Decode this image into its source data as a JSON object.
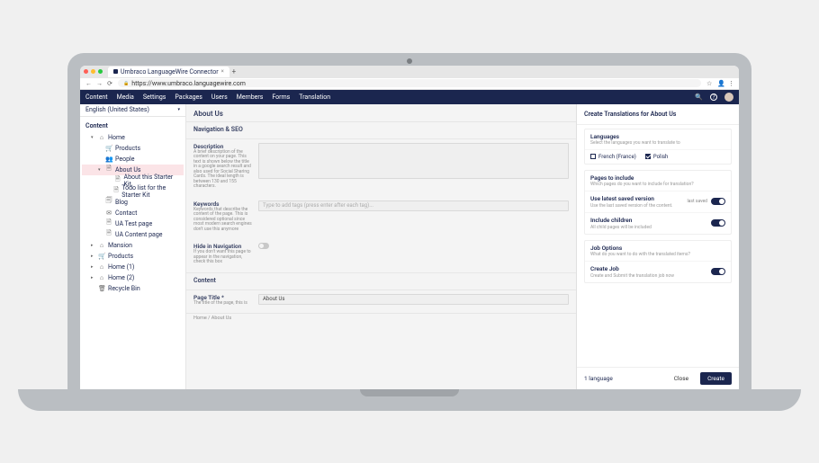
{
  "browser": {
    "tab_title": "Umbraco LanguageWire Connector",
    "url": "https://www.umbraco.languagewire.com",
    "back": "←",
    "forward": "→",
    "refresh": "⟳",
    "lock": "🔒",
    "star": "☆",
    "user": "👤",
    "menu": "⋮"
  },
  "app_menu": {
    "items": [
      "Content",
      "Media",
      "Settings",
      "Packages",
      "Users",
      "Members",
      "Forms",
      "Translation"
    ],
    "search_icon": "🔍",
    "help_icon": "?"
  },
  "sidebar": {
    "language": "English (United States)",
    "heading": "Content",
    "tree": [
      {
        "c": "▾",
        "ic": "⌂",
        "label": "Home",
        "depth": 1
      },
      {
        "c": "",
        "ic": "🛒",
        "label": "Products",
        "depth": 2
      },
      {
        "c": "",
        "ic": "👥",
        "label": "People",
        "depth": 2
      },
      {
        "c": "▾",
        "ic": "🗎",
        "label": "About Us",
        "depth": 2,
        "active": true
      },
      {
        "c": "",
        "ic": "🗎",
        "label": "About this Starter Kit",
        "depth": 3
      },
      {
        "c": "",
        "ic": "🗎",
        "label": "Todo list for the Starter Kit",
        "depth": 3
      },
      {
        "c": "",
        "ic": "🗐",
        "label": "Blog",
        "depth": 2
      },
      {
        "c": "",
        "ic": "✉",
        "label": "Contact",
        "depth": 2
      },
      {
        "c": "",
        "ic": "🗎",
        "label": "UA Test page",
        "depth": 2
      },
      {
        "c": "",
        "ic": "🗎",
        "label": "UA Content page",
        "depth": 2
      },
      {
        "c": "▸",
        "ic": "⌂",
        "label": "Mansion",
        "depth": 1
      },
      {
        "c": "▸",
        "ic": "🛒",
        "label": "Products",
        "depth": 1
      },
      {
        "c": "▸",
        "ic": "⌂",
        "label": "Home (1)",
        "depth": 1
      },
      {
        "c": "▸",
        "ic": "⌂",
        "label": "Home (2)",
        "depth": 1
      },
      {
        "c": "",
        "ic": "🗑",
        "label": "Recycle Bin",
        "depth": 1
      }
    ]
  },
  "main": {
    "title": "About Us",
    "nav_section": "Navigation & SEO",
    "desc": {
      "label": "Description",
      "help": "A brief description of the content on your page. This text is shown below the title in a google search result and also used for Social Sharing Cards. The ideal length is between 130 and 155 characters."
    },
    "keywords": {
      "label": "Keywords",
      "help": "Keywords that describe the content of the page. This is considered optional since most modern search engines don't use this anymore",
      "placeholder": "Type to add tags (press enter after each tag)..."
    },
    "hide": {
      "label": "Hide in Navigation",
      "help": "If you don't want this page to appear in the navigation, check this box"
    },
    "content_section": "Content",
    "page_title": {
      "label": "Page Title *",
      "help": "The title of the page, this is",
      "value": "About Us"
    },
    "breadcrumb": "Home / About Us"
  },
  "panel": {
    "title": "Create Translations for About Us",
    "languages": {
      "title": "Languages",
      "help": "Select the languages you want to translate to",
      "items": [
        {
          "label": "French (France)",
          "checked": false
        },
        {
          "label": "Polish",
          "checked": true
        }
      ]
    },
    "pages": {
      "title": "Pages to include",
      "help": "Which pages do you want to include for translation?",
      "latest": {
        "title": "Use latest saved version",
        "help": "Use the last saved version of the content.",
        "tag": "last saved"
      },
      "children": {
        "title": "Include children",
        "help": "All child pages will be included"
      }
    },
    "job": {
      "title": "Job Options",
      "help": "What do you want to do with the translated items?",
      "create": {
        "title": "Create Job",
        "help": "Create and Submit the translation job now"
      }
    },
    "footer": {
      "left": "1 language",
      "close": "Close",
      "create": "Create"
    }
  }
}
